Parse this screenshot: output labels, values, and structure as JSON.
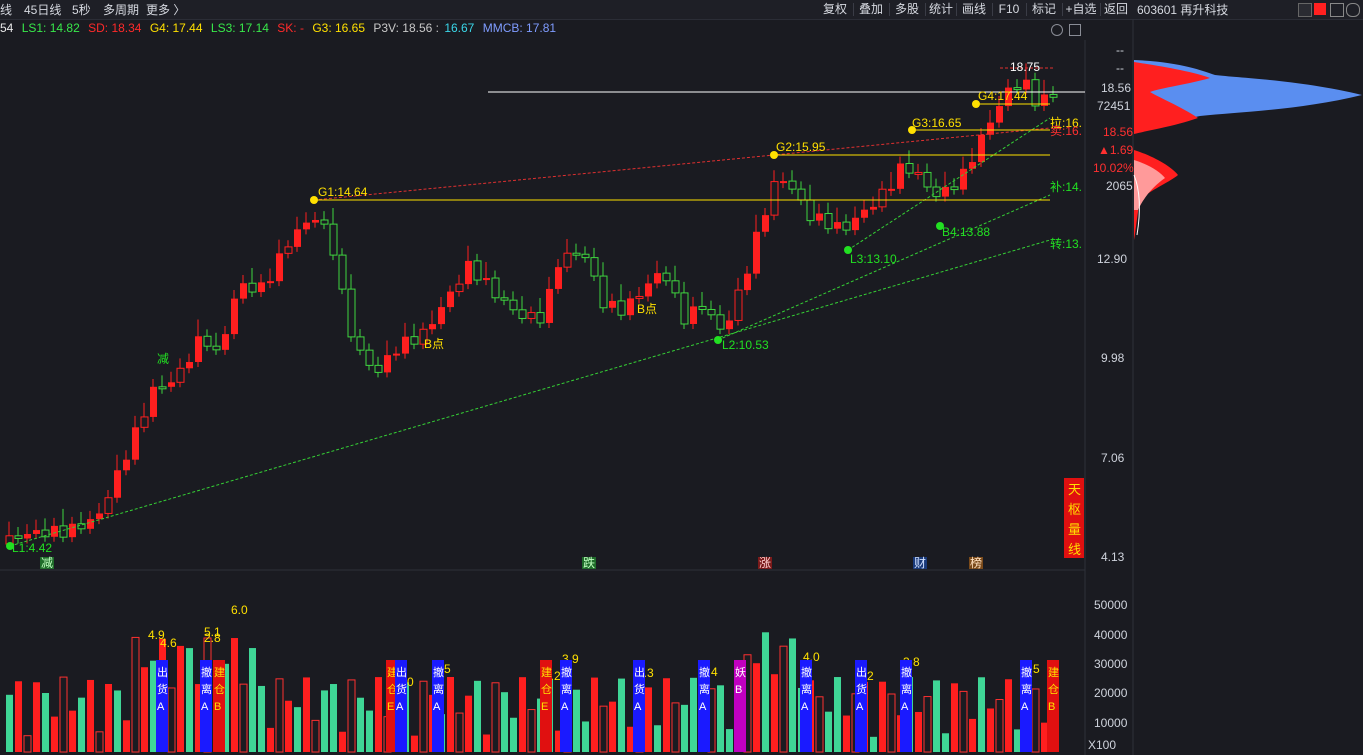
{
  "toolbar": {
    "left_items": [
      "线",
      "45日线",
      "5秒",
      "多周期",
      "更多 〉"
    ],
    "right_buttons": [
      "复权",
      "叠加",
      "多股",
      "统计",
      "画线",
      "F10",
      "标记",
      "+自选",
      "返回"
    ]
  },
  "stock": {
    "code_name": "603601 再升科技"
  },
  "legend": [
    {
      "text": "54",
      "color": "#e8e8e8"
    },
    {
      "text": "LS1: 14.82",
      "color": "#38e84a"
    },
    {
      "text": "SD: 18.34",
      "color": "#ff2a2a"
    },
    {
      "text": "G4: 17.44",
      "color": "#ffe000"
    },
    {
      "text": "LS3: 17.14",
      "color": "#38e84a"
    },
    {
      "text": "SK: -",
      "color": "#ff2a2a"
    },
    {
      "text": "G3: 16.65",
      "color": "#ffe000"
    },
    {
      "text": "P3V: 18.56 :",
      "color": "#c8c8c8"
    },
    {
      "text": "16.67",
      "color": "#3ad6e8"
    },
    {
      "text": "MMCB: 17.81",
      "color": "#7f9cff"
    }
  ],
  "price_axis": {
    "ticks": [
      "18.56",
      "12.90",
      "9.98",
      "7.06",
      "4.13"
    ],
    "top_marks": [
      "--",
      "--"
    ]
  },
  "volume_axis": {
    "ticks": [
      "50000",
      "40000",
      "30000",
      "20000",
      "10000"
    ],
    "unit": "X100"
  },
  "cost_panel": {
    "price_top": "18.56",
    "count_top": "72451",
    "price_red": "18.56",
    "change": "▲1.69",
    "pct": "10.02%",
    "count_bottom": "2065"
  },
  "price_labels": {
    "high": "18.75",
    "g1": "G1:14.64",
    "g2": "G2:15.95",
    "g3": "G3:16.65",
    "g4": "G4:17.44",
    "l1": "L1:4.42",
    "l2": "L2:10.53",
    "l3": "L3:13.10",
    "b4": "B4:13.88",
    "b_pt": "B点",
    "jian": "减",
    "la": "拉:16.",
    "mai": "卖:16.",
    "bu": "补:14.",
    "zhuan": "转:13."
  },
  "event_markers": [
    "减",
    "跌",
    "涨",
    "财",
    "榜"
  ],
  "tianshu": [
    "天",
    "枢",
    "量",
    "线"
  ],
  "volume_labels": [
    "4.9",
    "4.6",
    "5.1",
    "2.8",
    "6.0",
    "3.0",
    "3.5",
    "3.2",
    "3.9",
    "3.3",
    "3.4",
    "4.0",
    "3.2",
    "3.8",
    "3.5"
  ],
  "volume_tags": [
    "出货A",
    "撤离A",
    "建仓B",
    "建仓E",
    "出货A",
    "撤离A",
    "建仓E",
    "撤离A",
    "出货A",
    "撤离A",
    "妖B",
    "撤离A",
    "出货A",
    "撤离A",
    "撤离A",
    "建仓B"
  ],
  "colors": {
    "up": "#ff1f1f",
    "down": "#3fd696",
    "hollow_up": "#ff3030",
    "hollow_down": "#3fd63f",
    "yellow": "#ffe000",
    "bg": "#1a1b21"
  }
}
